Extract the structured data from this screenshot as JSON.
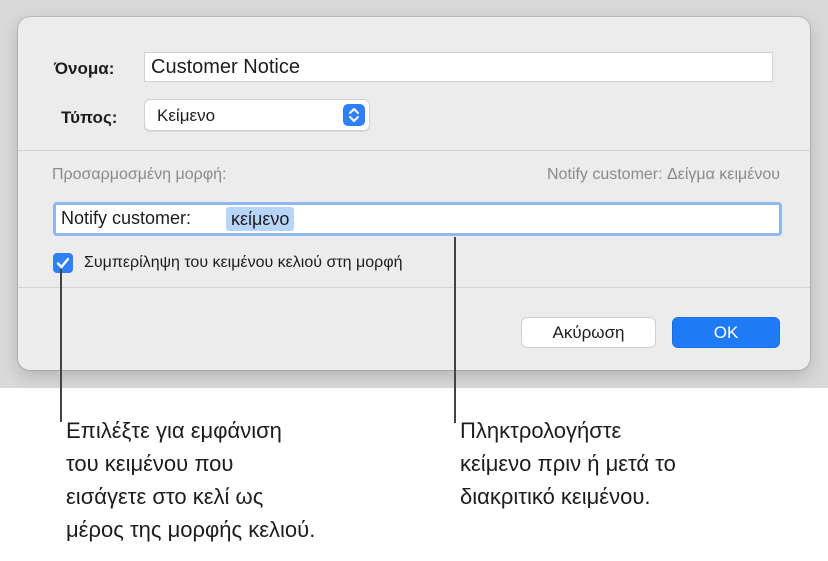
{
  "dialog": {
    "name_label": "Όνομα:",
    "name_value": "Customer Notice",
    "type_label": "Τύπος:",
    "type_value": "Κείμενο",
    "custom_format_label": "Προσαρμοσμένη μορφή:",
    "sample_text": "Notify customer: Δείγμα κειμένου",
    "format_prefix": "Notify customer:",
    "format_token": "κείμενο",
    "checkbox_checked": true,
    "checkbox_label": "Συμπερίληψη του κειμένου κελιού στη μορφή",
    "cancel_label": "Ακύρωση",
    "ok_label": "OK"
  },
  "callouts": {
    "left_text": "Επιλέξτε για εμφάνιση του κειμένου που εισάγετε στο κελί ως μέρος της μορφής κελιού.",
    "left_lines": [
      "Επιλέξτε για εμφάνιση",
      "του κειμένου που",
      "εισάγετε στο κελί ως",
      "μέρος της μορφής κελιού."
    ],
    "right_lines": [
      "Πληκτρολογήστε",
      "κείμενο πριν ή μετά το",
      "διακριτικό κειμένου."
    ]
  },
  "colors": {
    "accent": "#2f7ff5",
    "token_highlight": "#b7d5f9",
    "dialog_bg": "#ececec"
  },
  "icons": {
    "popup": "chevron-up-down-icon",
    "checkbox": "checkmark-icon"
  }
}
